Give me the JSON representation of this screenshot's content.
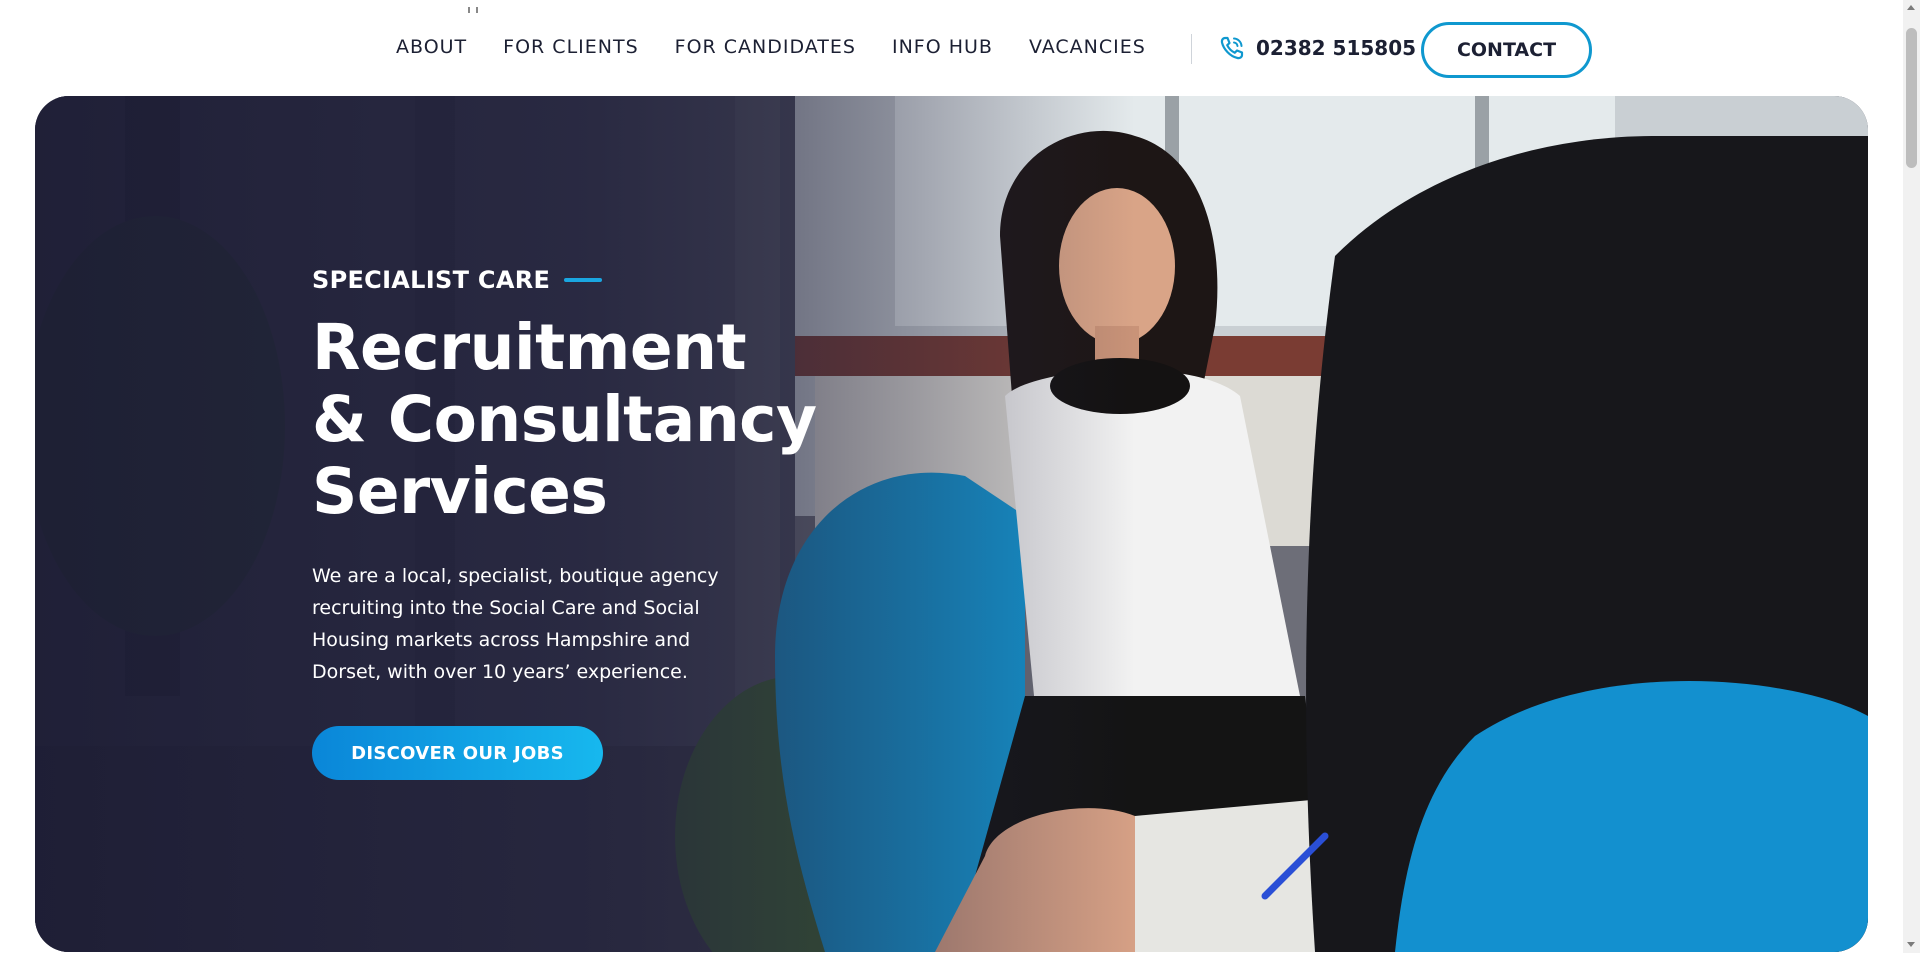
{
  "header": {
    "nav": [
      {
        "label": "ABOUT"
      },
      {
        "label": "FOR CLIENTS"
      },
      {
        "label": "FOR CANDIDATES"
      },
      {
        "label": "INFO HUB"
      },
      {
        "label": "VACANCIES"
      }
    ],
    "phone": {
      "icon": "phone-icon",
      "number": "02382 515805"
    },
    "contact_label": "CONTACT"
  },
  "hero": {
    "eyebrow": "SPECIALIST CARE",
    "title_lines": [
      "Recruitment",
      "& Consultancy",
      "Services"
    ],
    "description": "We are a local, specialist, boutique agency recruiting into the Social Care and Social Housing markets across Hampshire and Dorset, with over 10 years’ experience.",
    "cta_label": "DISCOVER OUR JOBS",
    "image_description": "Photo of a woman in a polka-dot top sitting in a blue chair across from another person"
  },
  "colors": {
    "accent": "#0f98cf",
    "cta_gradient_start": "#0a86d8",
    "cta_gradient_end": "#17b8ee",
    "nav_text": "#1c2033",
    "hero_text": "#ffffff"
  }
}
